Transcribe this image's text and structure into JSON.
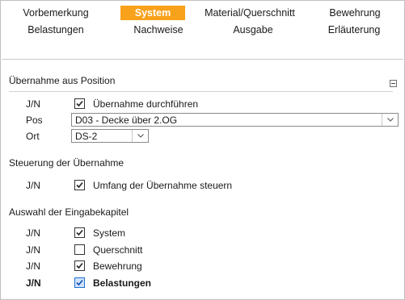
{
  "tabs": {
    "row1": [
      {
        "label": "Vorbemerkung",
        "active": false
      },
      {
        "label": "System",
        "active": true
      },
      {
        "label": "Material/Querschnitt",
        "active": false
      },
      {
        "label": "Bewehrung",
        "active": false
      }
    ],
    "row2": [
      {
        "label": "Belastungen",
        "active": false
      },
      {
        "label": "Nachweise",
        "active": false
      },
      {
        "label": "Ausgabe",
        "active": false
      },
      {
        "label": "Erläuterung",
        "active": false
      }
    ]
  },
  "sections": {
    "uebernahme": {
      "title": "Übernahme aus Position",
      "rows": {
        "jn_label": "J/N",
        "check_label": "Übernahme durchführen",
        "checked": true,
        "pos_label": "Pos",
        "pos_value": "D03 - Decke über 2.OG",
        "ort_label": "Ort",
        "ort_value": "DS-2"
      }
    },
    "steuerung": {
      "title": "Steuerung der Übernahme",
      "jn_label": "J/N",
      "check_label": "Umfang der Übernahme steuern",
      "checked": true
    },
    "auswahl": {
      "title": "Auswahl der Eingabekapitel",
      "items": [
        {
          "jn": "J/N",
          "label": "System",
          "checked": true
        },
        {
          "jn": "J/N",
          "label": "Querschnitt",
          "checked": false
        },
        {
          "jn": "J/N",
          "label": "Bewehrung",
          "checked": true
        },
        {
          "jn": "J/N",
          "label": "Belastungen",
          "checked": true,
          "focused": true
        }
      ]
    }
  },
  "colors": {
    "accent": "#f8a11a",
    "focus": "#1f6fd6"
  },
  "icons": {
    "check": "check-icon",
    "chevron": "chevron-down-icon",
    "collapse": "collapse-icon"
  }
}
